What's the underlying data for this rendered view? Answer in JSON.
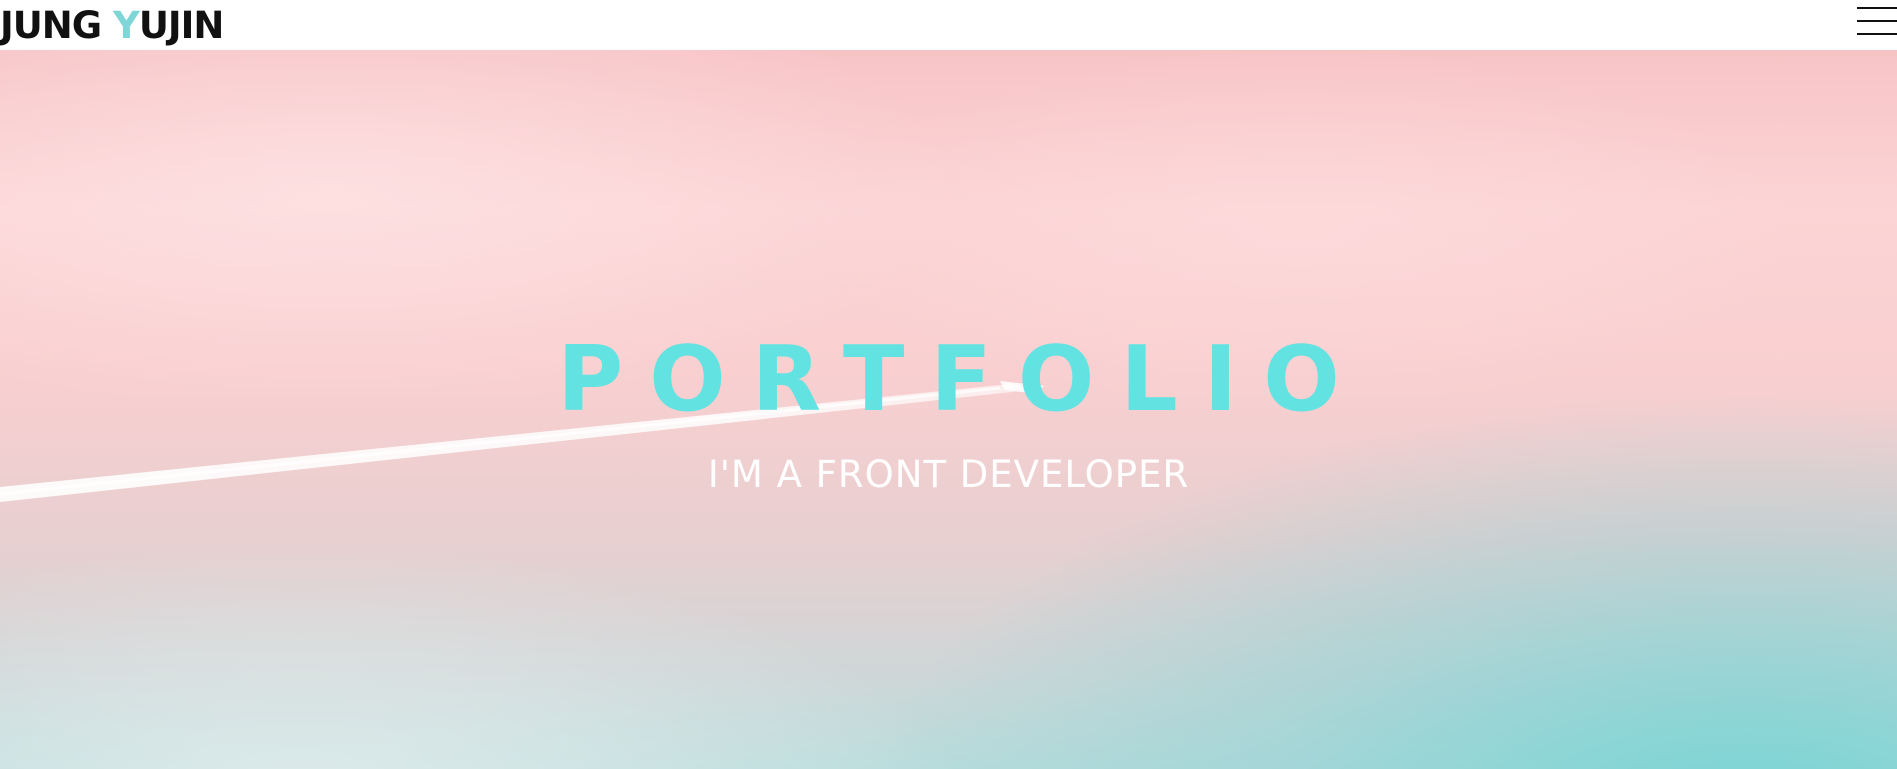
{
  "header": {
    "logo_prefix": "JUNG ",
    "logo_accent": "Y",
    "logo_suffix": "UJIN",
    "menu_icon": "hamburger-menu-icon"
  },
  "hero": {
    "title": "PORTFOLIO",
    "subtitle": "I'M A FRONT DEVELOPER",
    "background": "pink-to-teal sky photo with airplane contrail"
  },
  "colors": {
    "accent": "#63e2e2",
    "logo_accent": "#7fd6d6",
    "text_dark": "#111111",
    "subtitle": "#ffffff"
  }
}
